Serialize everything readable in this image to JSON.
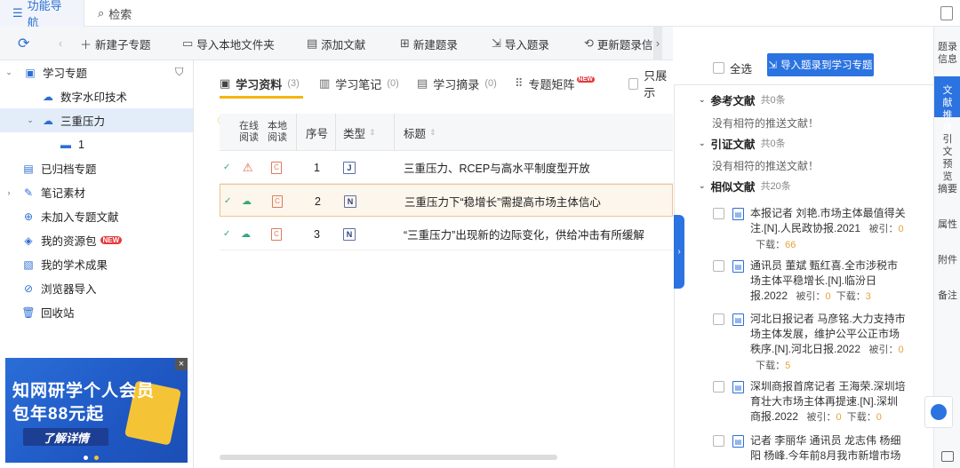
{
  "top_tabs": [
    {
      "label": "功能导航",
      "icon": "menu-icon"
    },
    {
      "label": "检索",
      "icon": "search-icon"
    }
  ],
  "toolbar": {
    "new_subtopic": "新建子专题",
    "import_folder": "导入本地文件夹",
    "add_literature": "添加文献",
    "new_excerpt": "新建题录",
    "import_excerpt": "导入题录",
    "update_excerpt": "更新题录信"
  },
  "sidebar": {
    "items": [
      {
        "label": "学习专题",
        "icon": "topic-icon"
      },
      {
        "label": "数字水印技术",
        "icon": "cloud-topic-icon"
      },
      {
        "label": "三重压力",
        "icon": "cloud-topic-icon"
      },
      {
        "label": "1",
        "icon": "folder-icon"
      },
      {
        "label": "已归档专题",
        "icon": "archive-icon"
      },
      {
        "label": "笔记素材",
        "icon": "note-icon"
      },
      {
        "label": "未加入专题文献",
        "icon": "literature-icon"
      },
      {
        "label": "我的资源包",
        "icon": "package-icon",
        "badge": "NEW"
      },
      {
        "label": "我的学术成果",
        "icon": "achievement-icon"
      },
      {
        "label": "浏览器导入",
        "icon": "browser-icon"
      },
      {
        "label": "回收站",
        "icon": "trash-icon"
      }
    ]
  },
  "ad": {
    "line1": "知网研学个人会员",
    "line2": "包年88元起",
    "button": "了解详情"
  },
  "main": {
    "tabs": [
      {
        "label": "学习资料",
        "count": "(3)"
      },
      {
        "label": "学习笔记",
        "count": "(0)"
      },
      {
        "label": "学习摘录",
        "count": "(0)"
      },
      {
        "label": "专题矩阵",
        "count": "",
        "badge": "NEW"
      }
    ],
    "show_only_label": "只展示",
    "table": {
      "headers": {
        "online_read_1": "在线",
        "online_read_2": "阅读",
        "local_read_1": "本地",
        "local_read_2": "阅读",
        "index": "序号",
        "type": "类型",
        "title": "标题"
      },
      "rows": [
        {
          "index": "1",
          "type": "J",
          "title": "三重压力、RCEP与高水平制度型开放"
        },
        {
          "index": "2",
          "type": "N",
          "title": "三重压力下“稳增长”需提高市场主体信心"
        },
        {
          "index": "3",
          "type": "N",
          "title": "“三重压力”出现新的边际变化，供给冲击有所缓解"
        }
      ]
    }
  },
  "right_panel": {
    "select_all": "全选",
    "import_button": "导入题录到学习专题",
    "sections": [
      {
        "title": "参考文献",
        "total": "共0条",
        "empty": "没有相符的推送文献！"
      },
      {
        "title": "引证文献",
        "total": "共0条",
        "empty": "没有相符的推送文献！"
      },
      {
        "title": "相似文献",
        "total": "共20条"
      }
    ],
    "similar_items": [
      {
        "text": "本报记者 刘艳.市场主体最值得关注.[N].人民政协报.2021",
        "cited_label": "被引：",
        "cited": "0",
        "download_label": "下载：",
        "downloads": "66"
      },
      {
        "text": "通讯员 董斌 甄红喜.全市涉税市场主体平稳增长.[N].临汾日报.2022",
        "cited_label": "被引：",
        "cited": "0",
        "download_label": "下载：",
        "downloads": "3"
      },
      {
        "text": "河北日报记者 马彦铭.大力支持市场主体发展，维护公平公正市场秩序.[N].河北日报.2022",
        "cited_label": "被引：",
        "cited": "0",
        "download_label": "下载：",
        "downloads": "5"
      },
      {
        "text": "深圳商报首席记者 王海荣.深圳培育壮大市场主体再提速.[N].深圳商报.2022",
        "cited_label": "被引：",
        "cited": "0",
        "download_label": "下载：",
        "downloads": "0"
      },
      {
        "text": "记者 李丽华 通讯员 龙志伟 杨细阳 杨峰.今年前8月我市新增市场"
      }
    ]
  },
  "right_tabs": [
    "题录信息",
    "文献推送",
    "引文预览",
    "摘要",
    "属性",
    "附件",
    "备注"
  ],
  "colors": {
    "accent": "#2b73e1",
    "highlight_border": "#f1c48d",
    "tab_underline": "#f5b50a",
    "count_orange": "#e6a23c"
  }
}
